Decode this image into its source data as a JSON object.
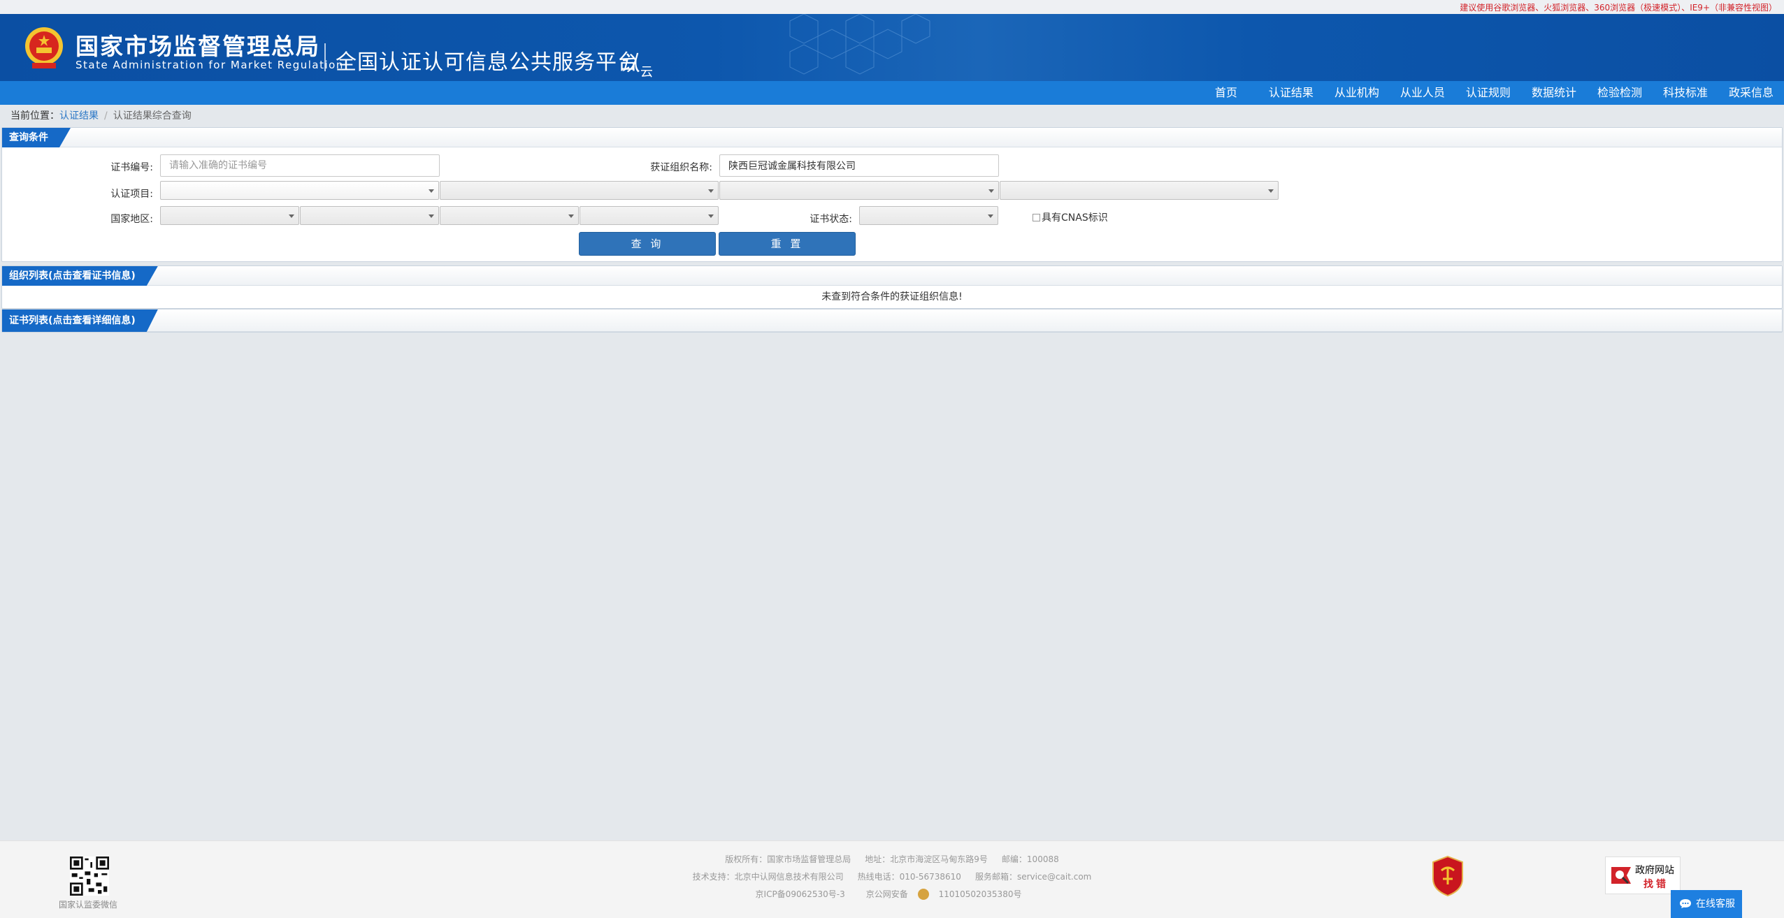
{
  "topbar": {
    "tip": "建议使用谷歌浏览器、火狐浏览器、360浏览器（极速模式）、IE9+（非兼容性视图）"
  },
  "header": {
    "brand_cn": "国家市场监督管理总局",
    "brand_en": "State Administration  for  Market Regulation",
    "platform": "全国认证认可信息公共服务平台",
    "cloud_main": "认",
    "cloud_sub": "云"
  },
  "nav": {
    "items": [
      "首页",
      "认证结果",
      "从业机构",
      "从业人员",
      "认证规则",
      "数据统计",
      "检验检测",
      "科技标准",
      "政采信息"
    ]
  },
  "breadcrumb": {
    "prefix": "当前位置：",
    "link": "认证结果",
    "sep": "/",
    "current": "认证结果综合查询"
  },
  "query_panel": {
    "title": "查询条件",
    "cert_no_label": "证书编号:",
    "cert_no_placeholder": "请输入准确的证书编号",
    "org_label": "获证组织名称:",
    "org_value": "陕西巨冠诚金属科技有限公司",
    "project_label": "认证项目:",
    "region_label": "国家地区:",
    "status_label": "证书状态:",
    "cnas_label": "具有CNAS标识",
    "search_button": "查 询",
    "reset_button": "重 置"
  },
  "org_panel": {
    "title": "组织列表(点击查看证书信息)",
    "empty": "未查到符合条件的获证组织信息!"
  },
  "cert_panel": {
    "title": "证书列表(点击查看详细信息)"
  },
  "footer": {
    "qr_caption": "国家认监委微信",
    "line1": [
      "版权所有：国家市场监督管理总局",
      "地址：北京市海淀区马甸东路9号",
      "邮编：100088"
    ],
    "line2": [
      "技术支持：北京中认网信息技术有限公司",
      "热线电话：010-56738610",
      "服务邮箱：service@cait.com"
    ],
    "line3_icp": "京ICP备09062530号-3",
    "line3_police": "京公网安备",
    "line3_police_no": "11010502035380号",
    "gov_err_t1": "政府网站",
    "gov_err_t2": "找错",
    "chat": "在线客服"
  },
  "colors": {
    "header_blue": "#0b4fa3",
    "nav_blue": "#1a7cd8",
    "tab_blue": "#1569c7",
    "button_blue": "#2f73b9",
    "tip_red": "#d2232a"
  }
}
